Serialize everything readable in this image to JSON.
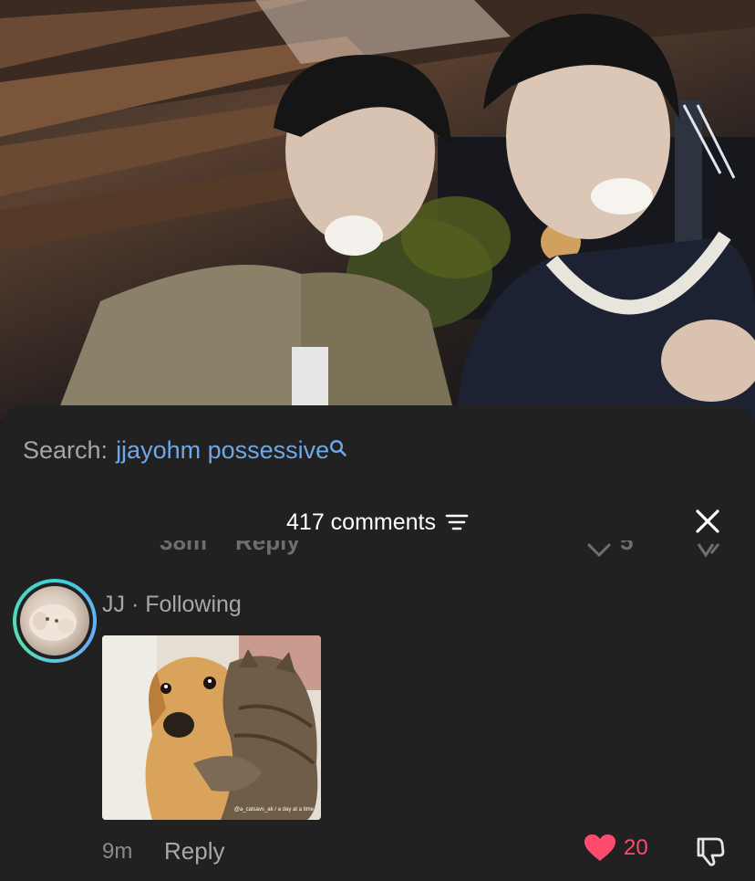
{
  "search": {
    "prefix": "Search:",
    "query": "jjayohm possessive",
    "icon": "search-icon"
  },
  "comments_header": {
    "count_label": "417 comments",
    "filter_icon": "filter-icon",
    "close_icon": "close-icon"
  },
  "previous_comment": {
    "time": "38m",
    "reply_label": "Reply",
    "like_count": "5"
  },
  "comment": {
    "username": "JJ",
    "separator": "·",
    "status": "Following",
    "time": "9m",
    "reply_label": "Reply",
    "like_count": "20",
    "liked": true,
    "gif_watermark": "@a_catsavs_ak / a day at a time"
  },
  "colors": {
    "accent_link": "#6fa8e8",
    "like_red": "#ff4b6e",
    "sheet_bg": "#212121"
  }
}
